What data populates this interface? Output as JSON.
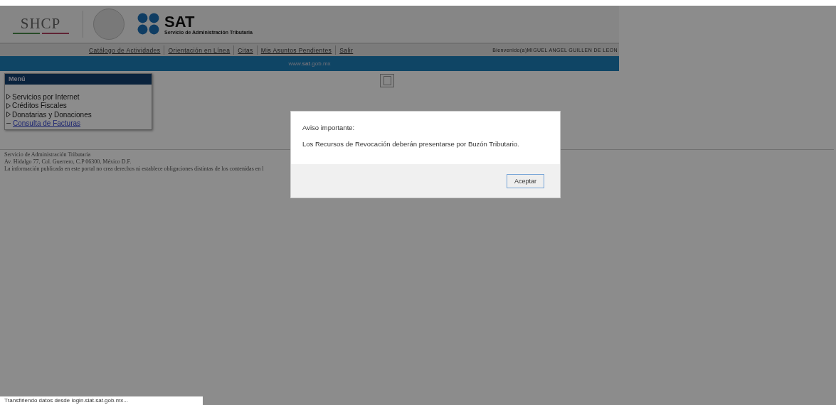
{
  "header": {
    "shcp_logo": "SHCP",
    "sat_logo": "SAT",
    "sat_subtitle": "Servicio de Administración Tributaria"
  },
  "nav": {
    "links": [
      {
        "label": "Catálogo de Actividades"
      },
      {
        "label": "Orientación en Línea"
      },
      {
        "label": "Citas"
      },
      {
        "label": "Mis Asuntos Pendientes"
      },
      {
        "label": "Salir"
      }
    ],
    "welcome": "Bienvenido(a)MIGUEL ANGEL GUILLEN DE LEON"
  },
  "banner": {
    "prefix": "www.",
    "bold": "sat",
    "suffix": ".gob.mx"
  },
  "menu": {
    "title": "Menú",
    "items": [
      {
        "kind": "folder",
        "label": "Servicios por Internet"
      },
      {
        "kind": "folder",
        "label": "Créditos Fiscales"
      },
      {
        "kind": "folder",
        "label": "Donatarias y Donaciones"
      },
      {
        "kind": "link",
        "label": "Consulta de Facturas"
      }
    ]
  },
  "footer": [
    "Servicio de Administración Tributaria",
    "Av. Hidalgo 77, Col. Guerrero, C.P 06300, México D.F.",
    "La información publicada en este portal no crea derechos ni establece obligaciones distintas de los contenidas en l"
  ],
  "dialog": {
    "title": "Aviso importante:",
    "message": "Los Recursos de Revocación deberán presentarse por Buzón Tributario.",
    "button": "Aceptar"
  },
  "status_bar": "Transfiriendo datos desde login.siat.sat.gob.mx..."
}
